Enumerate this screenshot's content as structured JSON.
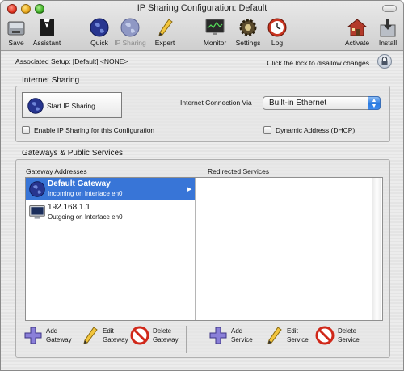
{
  "window": {
    "title": "IP Sharing Configuration: Default"
  },
  "toolbar": {
    "items": [
      {
        "label": "Save",
        "icon": "disk-icon"
      },
      {
        "label": "Assistant",
        "icon": "tuxedo-icon"
      },
      {
        "label": "Quick",
        "icon": "globe-icon"
      },
      {
        "label": "IP Sharing",
        "icon": "globe-icon"
      },
      {
        "label": "Expert",
        "icon": "pencil-icon"
      },
      {
        "label": "Monitor",
        "icon": "monitor-icon"
      },
      {
        "label": "Settings",
        "icon": "gear-icon"
      },
      {
        "label": "Log",
        "icon": "clock-icon"
      },
      {
        "label": "Activate",
        "icon": "house-icon"
      },
      {
        "label": "Install",
        "icon": "install-icon"
      }
    ]
  },
  "header": {
    "associated_setup": "Associated Setup: [Default] <NONE>",
    "lock_hint": "Click the lock to disallow changes"
  },
  "internet_sharing": {
    "section_title": "Internet Sharing",
    "start_button": "Start IP Sharing",
    "connection_label": "Internet Connection Via",
    "connection_value": "Built-in Ethernet",
    "enable_checkbox": "Enable IP Sharing for this Configuration",
    "dhcp_checkbox": "Dynamic Address (DHCP)"
  },
  "gateways": {
    "section_title": "Gateways & Public Services",
    "col_gateway": "Gateway Addresses",
    "col_redirected": "Redirected Services",
    "rows": [
      {
        "name": "Default Gateway",
        "detail": "Incoming on Interface en0"
      },
      {
        "name": "192.168.1.1",
        "detail": "Outgoing on Interface en0"
      }
    ]
  },
  "bottom": {
    "add_gateway": [
      "Add",
      "Gateway"
    ],
    "edit_gateway": [
      "Edit",
      "Gateway"
    ],
    "delete_gateway": [
      "Delete",
      "Gateway"
    ],
    "add_service": [
      "Add",
      "Service"
    ],
    "edit_service": [
      "Edit",
      "Service"
    ],
    "delete_service": [
      "Delete",
      "Service"
    ]
  },
  "colors": {
    "selection": "#3875d7",
    "popup_arrow": "#2b7be0"
  }
}
